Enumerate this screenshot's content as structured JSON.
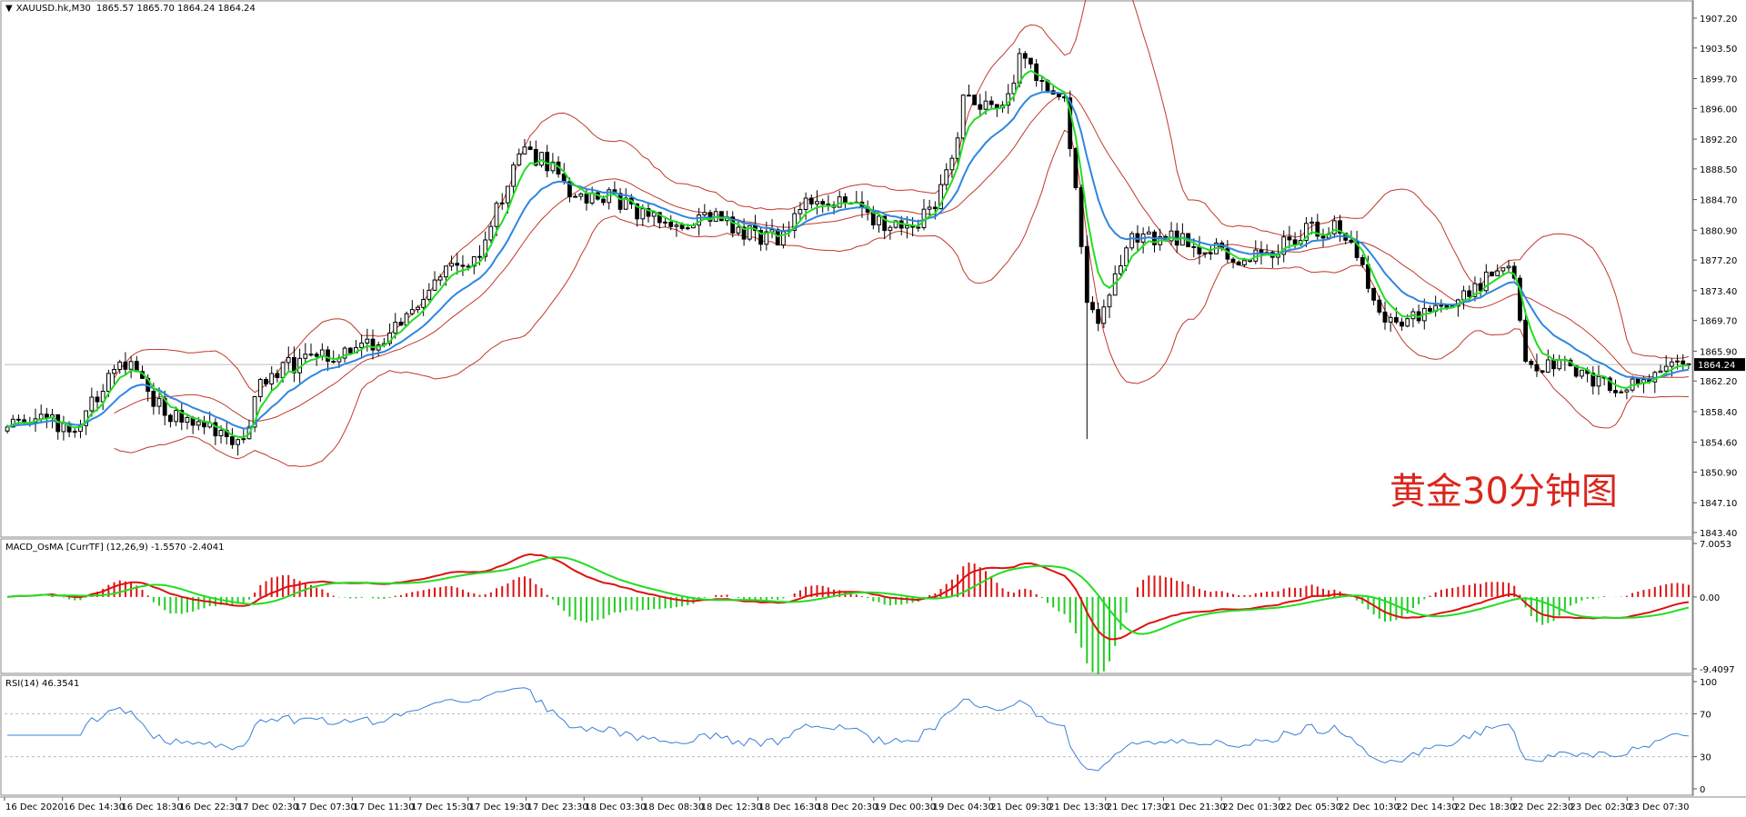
{
  "header": {
    "arrow": "▼",
    "symbol": "XAUUSD.hk,M30",
    "ohlc": "1865.57 1865.70 1864.24 1864.24"
  },
  "overlay_title": "黄金30分钟图",
  "macd": {
    "label": "MACD_OsMA [CurrTF] (12,26,9) -1.5570 -2.4041"
  },
  "rsi": {
    "label": "RSI(14) 46.3541"
  },
  "colors": {
    "bollinger": "#c0392b",
    "ma_fast": "#22dd22",
    "ma_slow": "#2f86e0",
    "macd_line": "#dd1111",
    "signal_line": "#22dd22",
    "hist_pos": "#dd1111",
    "hist_neg": "#22cc22",
    "rsi_line": "#3a80d9",
    "overlay_title": "#d9261c"
  },
  "chart_data": [
    {
      "type": "candlestick",
      "name": "price",
      "ylim": [
        1843.4,
        1909.0
      ],
      "y_ticks": [
        "1907.20",
        "1903.50",
        "1899.70",
        "1896.00",
        "1892.20",
        "1888.50",
        "1884.70",
        "1880.90",
        "1877.20",
        "1873.40",
        "1869.70",
        "1865.90",
        "1862.20",
        "1858.40",
        "1854.60",
        "1850.90",
        "1847.10",
        "1843.40"
      ],
      "current_price": "1864.24",
      "anchors": [
        [
          0,
          1857
        ],
        [
          6,
          1858
        ],
        [
          12,
          1856
        ],
        [
          18,
          1863
        ],
        [
          22,
          1864
        ],
        [
          28,
          1858
        ],
        [
          34,
          1857
        ],
        [
          40,
          1855
        ],
        [
          42,
          1854
        ],
        [
          45,
          1862
        ],
        [
          50,
          1864
        ],
        [
          56,
          1865
        ],
        [
          62,
          1866
        ],
        [
          68,
          1868
        ],
        [
          74,
          1873
        ],
        [
          78,
          1876
        ],
        [
          84,
          1878
        ],
        [
          88,
          1885
        ],
        [
          92,
          1891
        ],
        [
          96,
          1889
        ],
        [
          100,
          1886
        ],
        [
          104,
          1885
        ],
        [
          108,
          1885
        ],
        [
          112,
          1883
        ],
        [
          116,
          1882
        ],
        [
          120,
          1882
        ],
        [
          125,
          1883
        ],
        [
          130,
          1881
        ],
        [
          134,
          1880
        ],
        [
          138,
          1880
        ],
        [
          142,
          1884
        ],
        [
          146,
          1884
        ],
        [
          150,
          1884
        ],
        [
          155,
          1882
        ],
        [
          160,
          1881
        ],
        [
          164,
          1883
        ],
        [
          168,
          1889
        ],
        [
          170,
          1897
        ],
        [
          174,
          1896
        ],
        [
          178,
          1898
        ],
        [
          180,
          1902
        ],
        [
          182,
          1901
        ],
        [
          186,
          1898
        ],
        [
          188,
          1897
        ],
        [
          190,
          1887
        ],
        [
          192,
          1872
        ],
        [
          194,
          1869
        ],
        [
          196,
          1873
        ],
        [
          200,
          1880
        ],
        [
          204,
          1880
        ],
        [
          208,
          1880
        ],
        [
          212,
          1879
        ],
        [
          216,
          1878
        ],
        [
          220,
          1877
        ],
        [
          224,
          1878
        ],
        [
          228,
          1880
        ],
        [
          232,
          1881
        ],
        [
          236,
          1881
        ],
        [
          240,
          1878
        ],
        [
          244,
          1871
        ],
        [
          248,
          1869
        ],
        [
          252,
          1871
        ],
        [
          256,
          1872
        ],
        [
          260,
          1873
        ],
        [
          264,
          1876
        ],
        [
          266,
          1877
        ],
        [
          268,
          1874
        ],
        [
          270,
          1865
        ],
        [
          274,
          1864
        ],
        [
          278,
          1864
        ],
        [
          282,
          1862
        ],
        [
          286,
          1861
        ],
        [
          290,
          1862
        ],
        [
          294,
          1864
        ],
        [
          297,
          1865
        ],
        [
          299,
          1864.24
        ]
      ],
      "wick_spikes": [
        [
          192,
          1855
        ]
      ],
      "bollinger": {
        "period": 20,
        "deviation": 2
      },
      "ma_fast": {
        "period": 5
      },
      "ma_slow": {
        "period": 13
      }
    },
    {
      "type": "macd",
      "name": "MACD_OsMA",
      "ylim": [
        -9.4097,
        7.0053
      ],
      "y_ticks": [
        "7.0053",
        "0.00",
        "-9.4097"
      ]
    },
    {
      "type": "line",
      "name": "RSI(14)",
      "ylim": [
        0,
        100
      ],
      "y_ticks": [
        "100",
        "70",
        "30",
        "0"
      ],
      "levels": [
        70,
        30
      ]
    }
  ],
  "time_axis": {
    "labels": [
      "16 Dec 2020",
      "16 Dec 14:30",
      "16 Dec 18:30",
      "16 Dec 22:30",
      "17 Dec 02:30",
      "17 Dec 07:30",
      "17 Dec 11:30",
      "17 Dec 15:30",
      "17 Dec 19:30",
      "17 Dec 23:30",
      "18 Dec 03:30",
      "18 Dec 08:30",
      "18 Dec 12:30",
      "18 Dec 16:30",
      "18 Dec 20:30",
      "19 Dec 00:30",
      "19 Dec 04:30",
      "21 Dec 09:30",
      "21 Dec 13:30",
      "21 Dec 17:30",
      "21 Dec 21:30",
      "22 Dec 01:30",
      "22 Dec 05:30",
      "22 Dec 10:30",
      "22 Dec 14:30",
      "22 Dec 18:30",
      "22 Dec 22:30",
      "23 Dec 02:30",
      "23 Dec 07:30"
    ]
  }
}
